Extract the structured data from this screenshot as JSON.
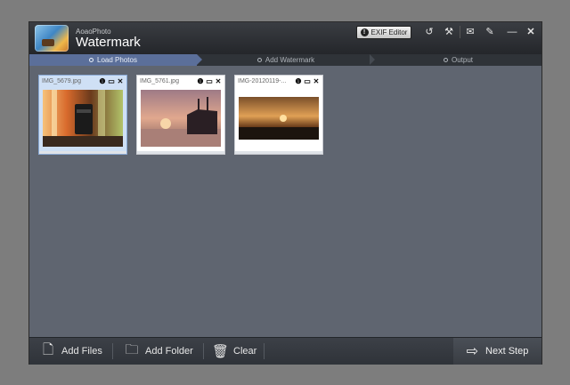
{
  "app": {
    "brand_small": "AoaoPhoto",
    "brand_big": "Watermark"
  },
  "toolbar": {
    "exif_label": "EXIF Editor",
    "icons": [
      "undo-icon",
      "tools-icon",
      "comment-icon",
      "register-icon",
      "minimize-icon",
      "close-icon"
    ]
  },
  "steps": [
    {
      "label": "Load Photos",
      "active": true
    },
    {
      "label": "Add Watermark",
      "active": false
    },
    {
      "label": "Output",
      "active": false
    }
  ],
  "photos": [
    {
      "name": "IMG_5679.jpg",
      "selected": true
    },
    {
      "name": "IMG_5761.jpg",
      "selected": false
    },
    {
      "name": "IMG-20120119-...",
      "selected": false
    }
  ],
  "bottom": {
    "add_files": "Add Files",
    "add_folder": "Add Folder",
    "clear": "Clear",
    "next": "Next Step"
  },
  "colors": {
    "accent": "#5b6f9a",
    "window_bg": "#5f6570",
    "titlebar": "#2b2e33"
  }
}
